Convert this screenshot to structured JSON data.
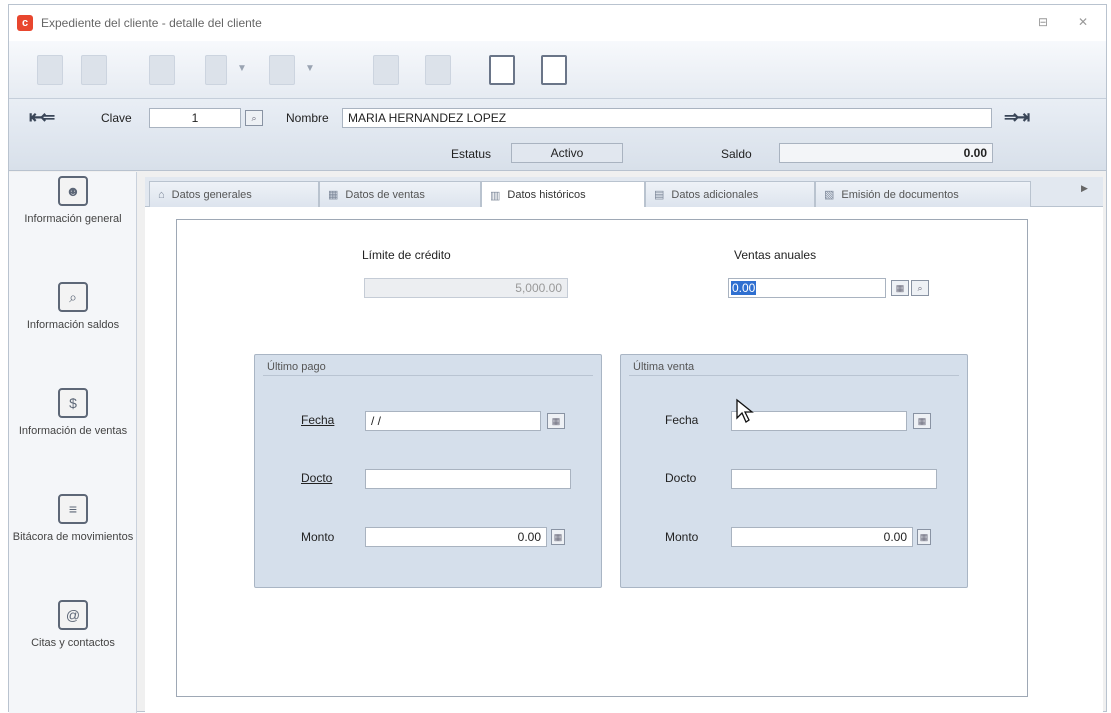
{
  "window": {
    "title": "Expediente del cliente - detalle del cliente",
    "btn_restore": "⊟",
    "btn_close": "✕"
  },
  "record": {
    "clave_label": "Clave",
    "clave_value": "1",
    "nombre_label": "Nombre",
    "nombre_value": "MARIA HERNANDEZ LOPEZ",
    "estatus_label": "Estatus",
    "estatus_value": "Activo",
    "saldo_label": "Saldo",
    "saldo_value": "0.00"
  },
  "sidebar": {
    "items": [
      {
        "label": "Información general"
      },
      {
        "label": "Información saldos"
      },
      {
        "label": "Información de ventas"
      },
      {
        "label": "Bitácora de movimientos"
      },
      {
        "label": "Citas y contactos"
      }
    ]
  },
  "tabs": [
    {
      "label": "Datos generales"
    },
    {
      "label": "Datos de ventas"
    },
    {
      "label": "Datos históricos"
    },
    {
      "label": "Datos adicionales"
    },
    {
      "label": "Emisión de documentos"
    }
  ],
  "historicos": {
    "limite_label": "Límite de crédito",
    "limite_value": "5,000.00",
    "ventas_label": "Ventas anuales",
    "ventas_value": "0.00",
    "ultimo_pago": {
      "legend": "Último pago",
      "fecha_label": "Fecha",
      "fecha_value": "/ /",
      "docto_label": "Docto",
      "docto_value": "",
      "monto_label": "Monto",
      "monto_value": "0.00"
    },
    "ultima_venta": {
      "legend": "Última venta",
      "fecha_label": "Fecha",
      "fecha_value": "",
      "docto_label": "Docto",
      "docto_value": "",
      "monto_label": "Monto",
      "monto_value": "0.00"
    }
  }
}
